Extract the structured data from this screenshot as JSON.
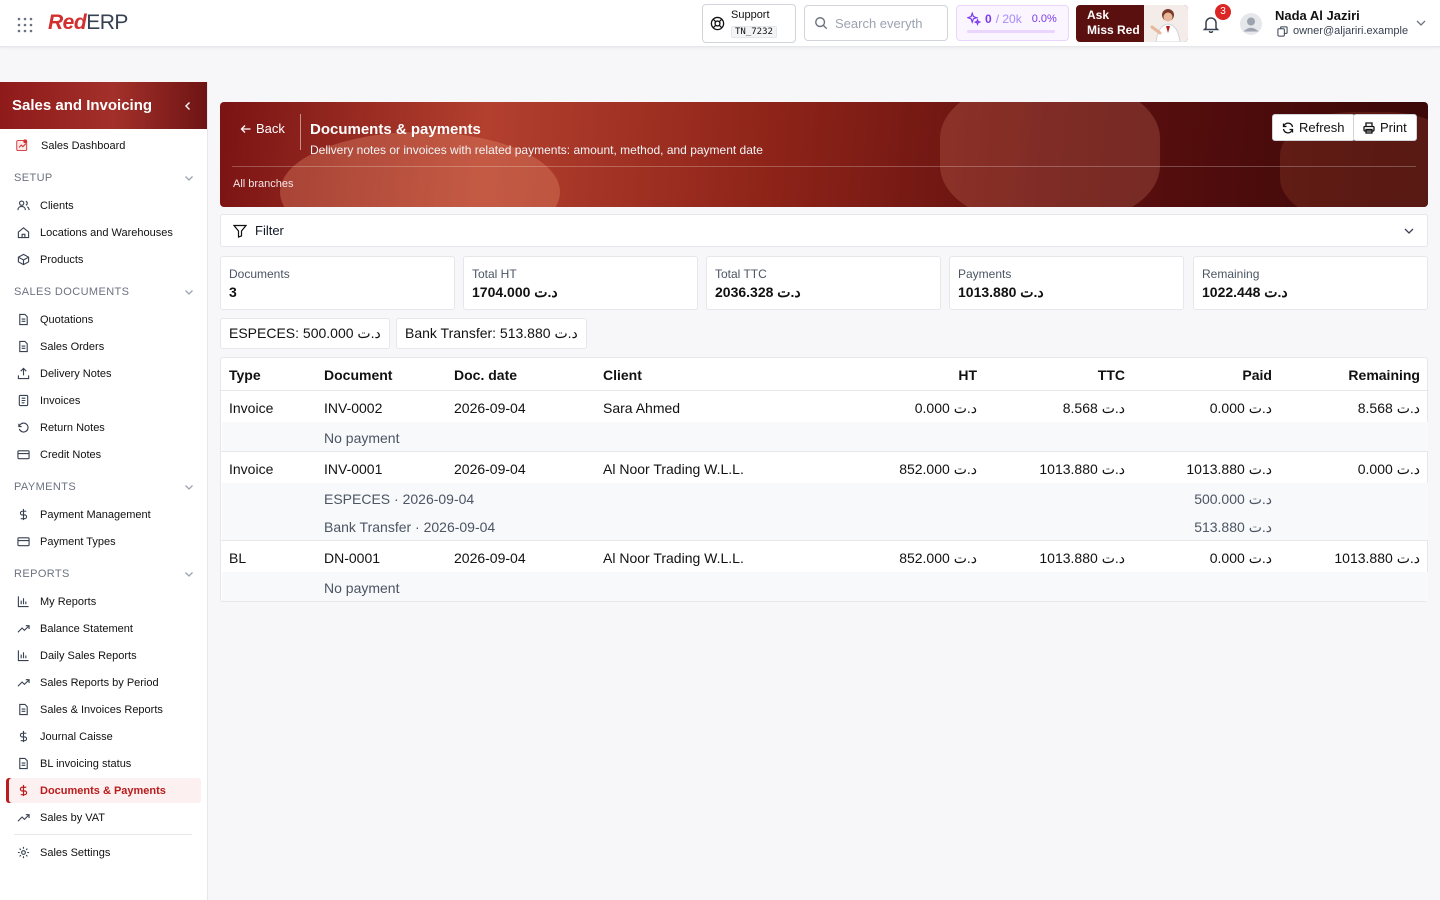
{
  "topbar": {
    "logo_red": "Red",
    "logo_erp": "ERP",
    "support_label": "Support",
    "support_code": "TN_7232",
    "search_placeholder": "Search everyth",
    "tokens_used": "0",
    "tokens_limit": "/ 20k",
    "tokens_percent": "0.0%",
    "tokens_fraction": 0.0,
    "ask_line1": "Ask",
    "ask_line2": "Miss Red",
    "notifications_count": "3",
    "user_name": "Nada Al Jaziri",
    "user_email": "owner@aljariri.example"
  },
  "sidebar": {
    "title": "Sales and Invoicing",
    "dashboard": "Sales Dashboard",
    "sections": {
      "setup": "SETUP",
      "sales_documents": "SALES DOCUMENTS",
      "payments": "PAYMENTS",
      "reports": "REPORTS"
    },
    "items": {
      "clients": "Clients",
      "locations": "Locations and Warehouses",
      "products": "Products",
      "quotations": "Quotations",
      "sales_orders": "Sales Orders",
      "delivery_notes": "Delivery Notes",
      "invoices": "Invoices",
      "return_notes": "Return Notes",
      "credit_notes": "Credit Notes",
      "payment_management": "Payment Management",
      "payment_types": "Payment Types",
      "my_reports": "My Reports",
      "balance_statement": "Balance Statement",
      "daily_sales": "Daily Sales Reports",
      "sales_by_period": "Sales Reports by Period",
      "sales_invoices_reports": "Sales & Invoices Reports",
      "journal_caisse": "Journal Caisse",
      "bl_invoicing": "BL invoicing status",
      "documents_payments": "Documents & Payments",
      "sales_by_vat": "Sales by VAT",
      "sales_settings": "Sales Settings"
    }
  },
  "header": {
    "back": "Back",
    "title": "Documents & payments",
    "subtitle": "Delivery notes or invoices with related payments: amount, method, and payment date",
    "branch": "All branches",
    "refresh": "Refresh",
    "print": "Print"
  },
  "filter": {
    "label": "Filter"
  },
  "stats": {
    "documents": {
      "label": "Documents",
      "value": "3"
    },
    "total_ht": {
      "label": "Total HT",
      "value": "1704.000 د.ت"
    },
    "total_ttc": {
      "label": "Total TTC",
      "value": "2036.328 د.ت"
    },
    "payments": {
      "label": "Payments",
      "value": "1013.880 د.ت"
    },
    "remaining": {
      "label": "Remaining",
      "value": "1022.448 د.ت"
    }
  },
  "method_totals": {
    "especes": "ESPECES: 500.000 د.ت",
    "bank": "Bank Transfer: 513.880 د.ت"
  },
  "table": {
    "headers": {
      "type": "Type",
      "document": "Document",
      "date": "Doc. date",
      "client": "Client",
      "ht": "HT",
      "ttc": "TTC",
      "paid": "Paid",
      "remaining": "Remaining"
    },
    "rows": [
      {
        "type": "Invoice",
        "document": "INV-0002",
        "date": "2026-09-04",
        "client": "Sara Ahmed",
        "ht": "0.000 د.ت",
        "ttc": "8.568 د.ت",
        "paid": "0.000 د.ت",
        "remaining": "8.568 د.ت",
        "no_payment": "No payment"
      },
      {
        "type": "Invoice",
        "document": "INV-0001",
        "date": "2026-09-04",
        "client": "Al Noor Trading W.L.L.",
        "ht": "852.000 د.ت",
        "ttc": "1013.880 د.ت",
        "paid": "1013.880 د.ت",
        "remaining": "0.000 د.ت",
        "payments": [
          {
            "label": "ESPECES · 2026-09-04",
            "amount": "500.000 د.ت"
          },
          {
            "label": "Bank Transfer · 2026-09-04",
            "amount": "513.880 د.ت"
          }
        ]
      },
      {
        "type": "BL",
        "document": "DN-0001",
        "date": "2026-09-04",
        "client": "Al Noor Trading W.L.L.",
        "ht": "852.000 د.ت",
        "ttc": "1013.880 د.ت",
        "paid": "0.000 د.ت",
        "remaining": "1013.880 د.ت",
        "no_payment": "No payment"
      }
    ]
  },
  "colors": {
    "brand_red": "#b91c1c",
    "banner_dark": "#5b1010",
    "token_purple": "#7c3aed"
  }
}
